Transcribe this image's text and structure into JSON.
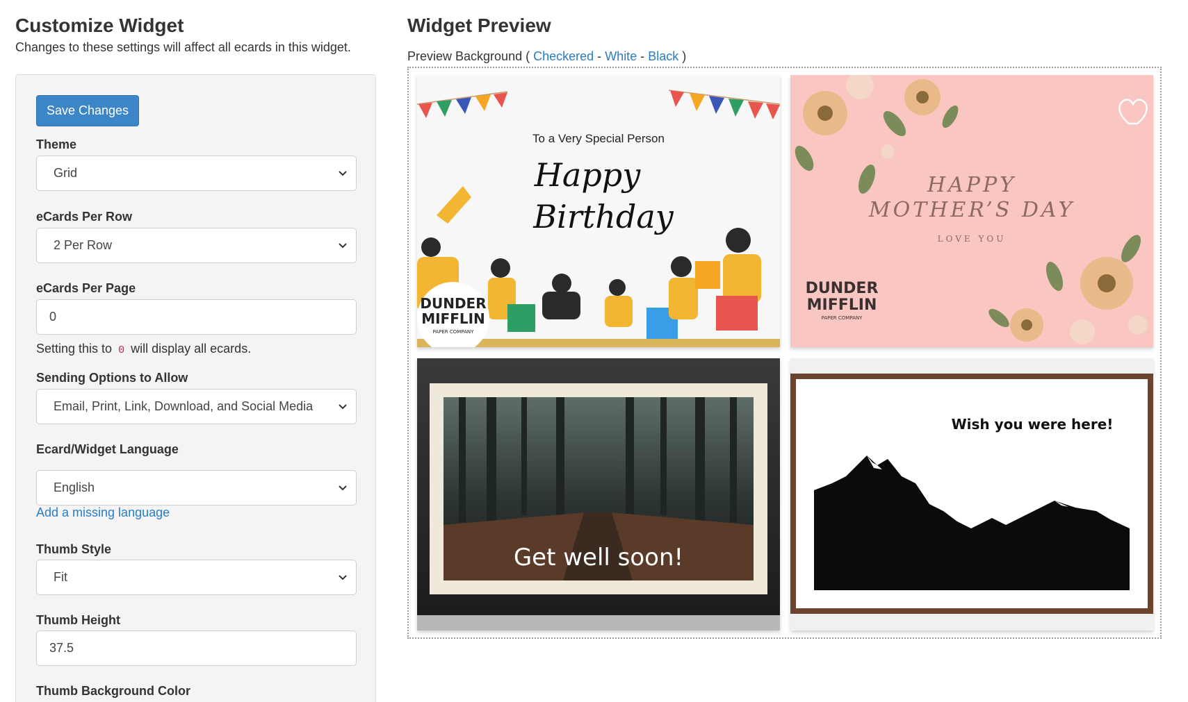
{
  "left": {
    "title": "Customize Widget",
    "subtitle": "Changes to these settings will affect all ecards in this widget.",
    "save_label": "Save Changes",
    "theme": {
      "label": "Theme",
      "value": "Grid"
    },
    "per_row": {
      "label": "eCards Per Row",
      "value": "2 Per Row"
    },
    "per_page": {
      "label": "eCards Per Page",
      "value": "0",
      "help_before": "Setting this to",
      "help_code": "0",
      "help_after": "will display all ecards."
    },
    "sending": {
      "label": "Sending Options to Allow",
      "value": "Email, Print, Link, Download, and Social Media"
    },
    "language": {
      "label": "Ecard/Widget Language",
      "value": "English",
      "link": "Add a missing language"
    },
    "thumb_style": {
      "label": "Thumb Style",
      "value": "Fit"
    },
    "thumb_height": {
      "label": "Thumb Height",
      "value": "37.5"
    },
    "thumb_bg": {
      "label": "Thumb Background Color"
    }
  },
  "preview": {
    "title": "Widget Preview",
    "bg_label": "Preview Background (",
    "bg_close": ")",
    "options": [
      "Checkered",
      "White",
      "Black"
    ],
    "separator": "-",
    "cards": [
      {
        "line1": "To a Very Special Person",
        "line2": "Happy",
        "line3": "Birthday",
        "brand1": "DUNDER",
        "brand2": "MIFFLIN",
        "brand3": "PAPER COMPANY"
      },
      {
        "line1": "HAPPY",
        "line2": "MOTHER’S DAY",
        "line3": "LOVE YOU",
        "brand1": "DUNDER",
        "brand2": "MIFFLIN",
        "brand3": "PAPER COMPANY"
      },
      {
        "text": "Get well soon!"
      },
      {
        "text": "Wish you were here!"
      }
    ]
  },
  "colors": {
    "accent": "#3c85c9",
    "link": "#2a7cc7",
    "panel": "#f4f4f4",
    "card_pink": "#f9c6c1"
  },
  "icons": [
    "chevron-down-icon",
    "heart-icon"
  ]
}
